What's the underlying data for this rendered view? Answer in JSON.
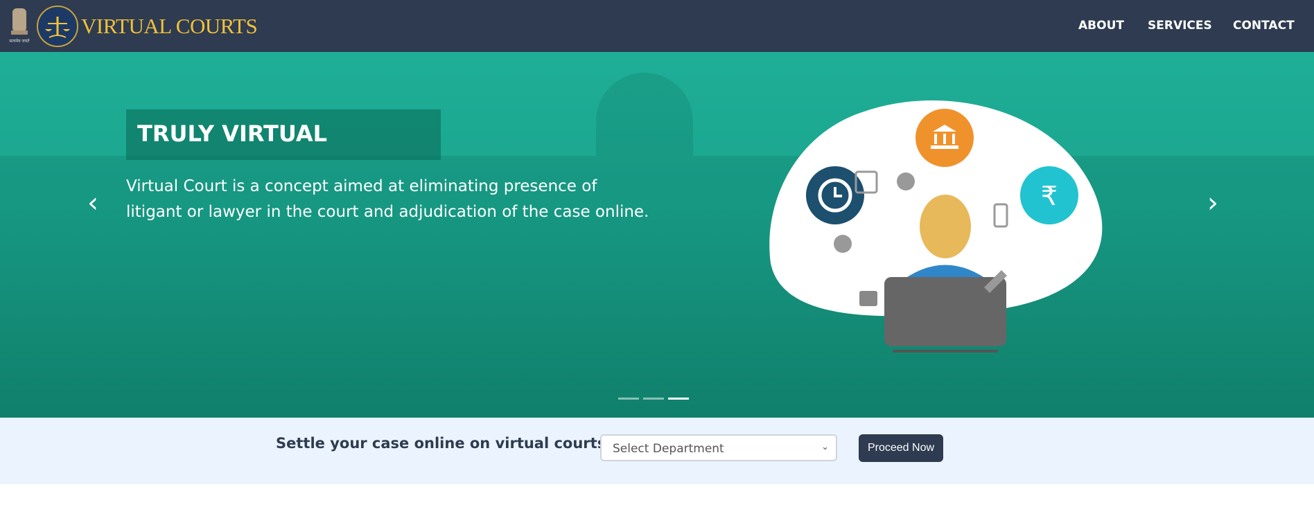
{
  "header": {
    "brand": "VIRTUAL COURTS",
    "emblem_motto": "सत्यमेव जयते",
    "nav": [
      "ABOUT",
      "SERVICES",
      "CONTACT"
    ]
  },
  "hero": {
    "title": "TRULY VIRTUAL",
    "description": "Virtual Court is a concept aimed at eliminating presence of litigant or lawyer in the court and adjudication of the case online.",
    "prev": "‹",
    "next": "›",
    "slides": 3,
    "active_slide": 3,
    "rupee": "₹"
  },
  "cta": {
    "heading": "Settle your case online on virtual courts",
    "select_value": "Select Department",
    "button": "Proceed Now"
  },
  "colors": {
    "header": "#2e3b50",
    "hero": "#1fae97",
    "brand": "#f2c13a",
    "band": "#ebf4fe"
  }
}
